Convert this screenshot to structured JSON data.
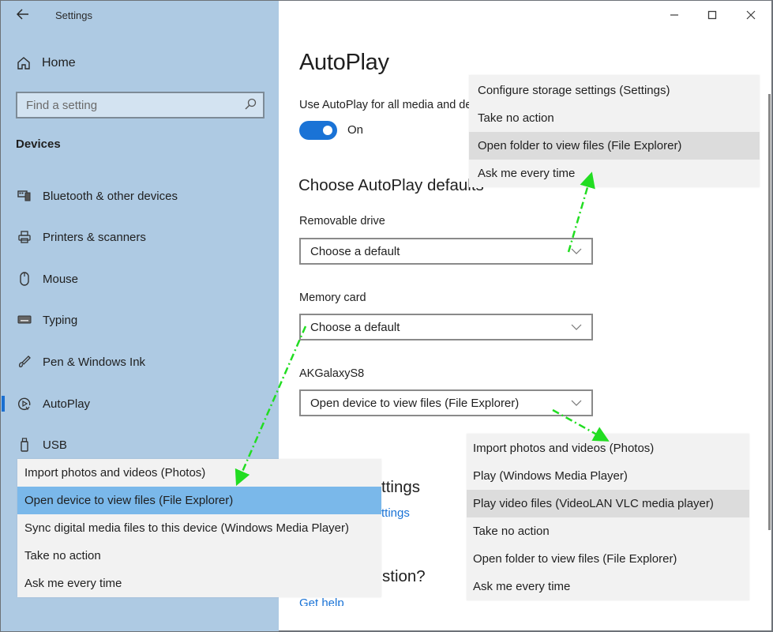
{
  "window": {
    "app_title": "Settings",
    "controls": {
      "minimize": "minimize",
      "maximize": "maximize",
      "close": "close"
    }
  },
  "sidebar": {
    "back_icon": "arrow-left-icon",
    "home_label": "Home",
    "search_placeholder": "Find a setting",
    "section_heading": "Devices",
    "items": [
      {
        "label": "Bluetooth & other devices",
        "icon": "bluetooth-devices-icon",
        "active": false
      },
      {
        "label": "Printers & scanners",
        "icon": "printer-icon",
        "active": false
      },
      {
        "label": "Mouse",
        "icon": "mouse-icon",
        "active": false
      },
      {
        "label": "Typing",
        "icon": "keyboard-icon",
        "active": false
      },
      {
        "label": "Pen & Windows Ink",
        "icon": "pen-icon",
        "active": false
      },
      {
        "label": "AutoPlay",
        "icon": "autoplay-icon",
        "active": true
      },
      {
        "label": "USB",
        "icon": "usb-icon",
        "active": false
      }
    ]
  },
  "main": {
    "title": "AutoPlay",
    "toggle": {
      "label": "Use AutoPlay for all media and devices",
      "state_label": "On",
      "on": true
    },
    "defaults_heading": "Choose AutoPlay defaults",
    "fields": [
      {
        "label": "Removable drive",
        "value": "Choose a default"
      },
      {
        "label": "Memory card",
        "value": "Choose a default"
      },
      {
        "label": "AKGalaxyS8",
        "value": "Open device to view files (File Explorer)"
      }
    ],
    "partial_visible": {
      "related_heading_fragment": "ttings",
      "related_link_fragment": "ttings",
      "question_heading_fragment": "stion?",
      "help_link": "Get help"
    }
  },
  "popups": {
    "removable_drive": {
      "options": [
        "Configure storage settings (Settings)",
        "Take no action",
        "Open folder to view files (File Explorer)",
        "Ask me every time"
      ],
      "hovered_index": 2
    },
    "memory_card": {
      "options": [
        "Import photos and videos (Photos)",
        "Open device to view files (File Explorer)",
        "Sync digital media files to this device (Windows Media Player)",
        "Take no action",
        "Ask me every time"
      ],
      "selected_index": 1
    },
    "phone": {
      "options": [
        "Import photos and videos (Photos)",
        "Play (Windows Media Player)",
        "Play video files (VideoLAN VLC media player)",
        "Take no action",
        "Open folder to view files (File Explorer)",
        "Ask me every time"
      ],
      "hovered_index": 2
    }
  },
  "colors": {
    "sidebar_bg": "#aecae3",
    "accent": "#1a73d6",
    "selected_option": "#7ab8ea",
    "annotation_arrow": "#22dd22"
  }
}
